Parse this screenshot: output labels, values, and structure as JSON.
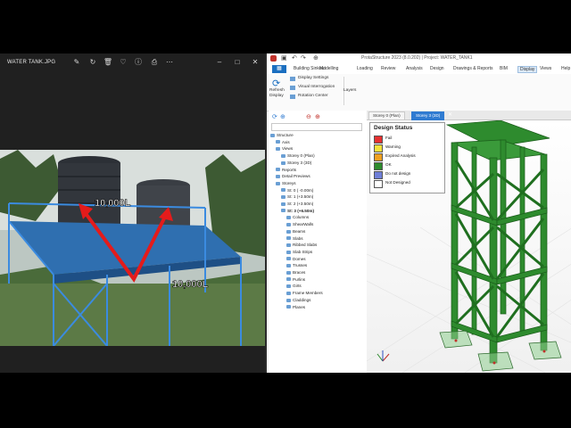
{
  "viewer": {
    "title": "WATER TANK.JPG",
    "photo_labels": [
      "10,000L",
      "10,000L"
    ]
  },
  "app": {
    "title": "ProtaStructure 2023 (8.0.202) | Project: WATER_TANK1",
    "ribbon_tabs": [
      "Building Sinkout",
      "Modelling",
      "Loading",
      "Review",
      "Analysis",
      "Design",
      "Drawings & Reports",
      "BIM",
      "Display",
      "Views",
      "Help"
    ],
    "active_tab": "Display",
    "file_tab": "▦",
    "ribbon": {
      "refresh": "Refresh\nDisplay",
      "display_settings": "Display Settings",
      "visual_interrogation": "Visual Interrogation",
      "rotation_center": "Rotation Center",
      "layers": "Layers"
    },
    "tree": [
      {
        "label": "Structure",
        "indent": 0
      },
      {
        "label": "Axis",
        "indent": 1
      },
      {
        "label": "Views",
        "indent": 1
      },
      {
        "label": "Storey 0 (Plan)",
        "indent": 2
      },
      {
        "label": "Storey 3 (3D)",
        "indent": 2
      },
      {
        "label": "Reports",
        "indent": 1
      },
      {
        "label": "Detail Previews",
        "indent": 1
      },
      {
        "label": "Storeys",
        "indent": 1
      },
      {
        "label": "St: 0 ( -0.00m)",
        "indent": 2
      },
      {
        "label": "St: 1 (+3.50m)",
        "indent": 2
      },
      {
        "label": "St: 2 (+3.50m)",
        "indent": 2
      },
      {
        "label": "St: 3 (+6.50m)",
        "indent": 2,
        "bold": true
      },
      {
        "label": "Columns",
        "indent": 3
      },
      {
        "label": "ShearWalls",
        "indent": 3
      },
      {
        "label": "Beams",
        "indent": 3
      },
      {
        "label": "Slabs",
        "indent": 3
      },
      {
        "label": "Ribbed Slabs",
        "indent": 3
      },
      {
        "label": "Slab Strips",
        "indent": 3
      },
      {
        "label": "Domes",
        "indent": 3
      },
      {
        "label": "Trusses",
        "indent": 3
      },
      {
        "label": "Braces",
        "indent": 3
      },
      {
        "label": "Purlins",
        "indent": 3
      },
      {
        "label": "Girts",
        "indent": 3
      },
      {
        "label": "Frame Members",
        "indent": 3
      },
      {
        "label": "Claddings",
        "indent": 3
      },
      {
        "label": "Planes",
        "indent": 3
      }
    ],
    "view_tabs": [
      {
        "label": "Storey 0 (Plan)",
        "active": false
      },
      {
        "label": "Storey 3 (3D)",
        "active": true
      }
    ],
    "legend": {
      "title": "Design Status",
      "items": [
        {
          "label": "Fail",
          "color": "#e53030"
        },
        {
          "label": "Warning",
          "color": "#f4e23a"
        },
        {
          "label": "Expired Analysis",
          "color": "#f0a020"
        },
        {
          "label": "OK",
          "color": "#2e8b2e"
        },
        {
          "label": "Do not design",
          "color": "#6f7fd8"
        },
        {
          "label": "Not Designed",
          "color": "#ffffff"
        }
      ]
    },
    "colors": {
      "accent": "#1b6fc0",
      "member": "#2e8b2e"
    }
  }
}
